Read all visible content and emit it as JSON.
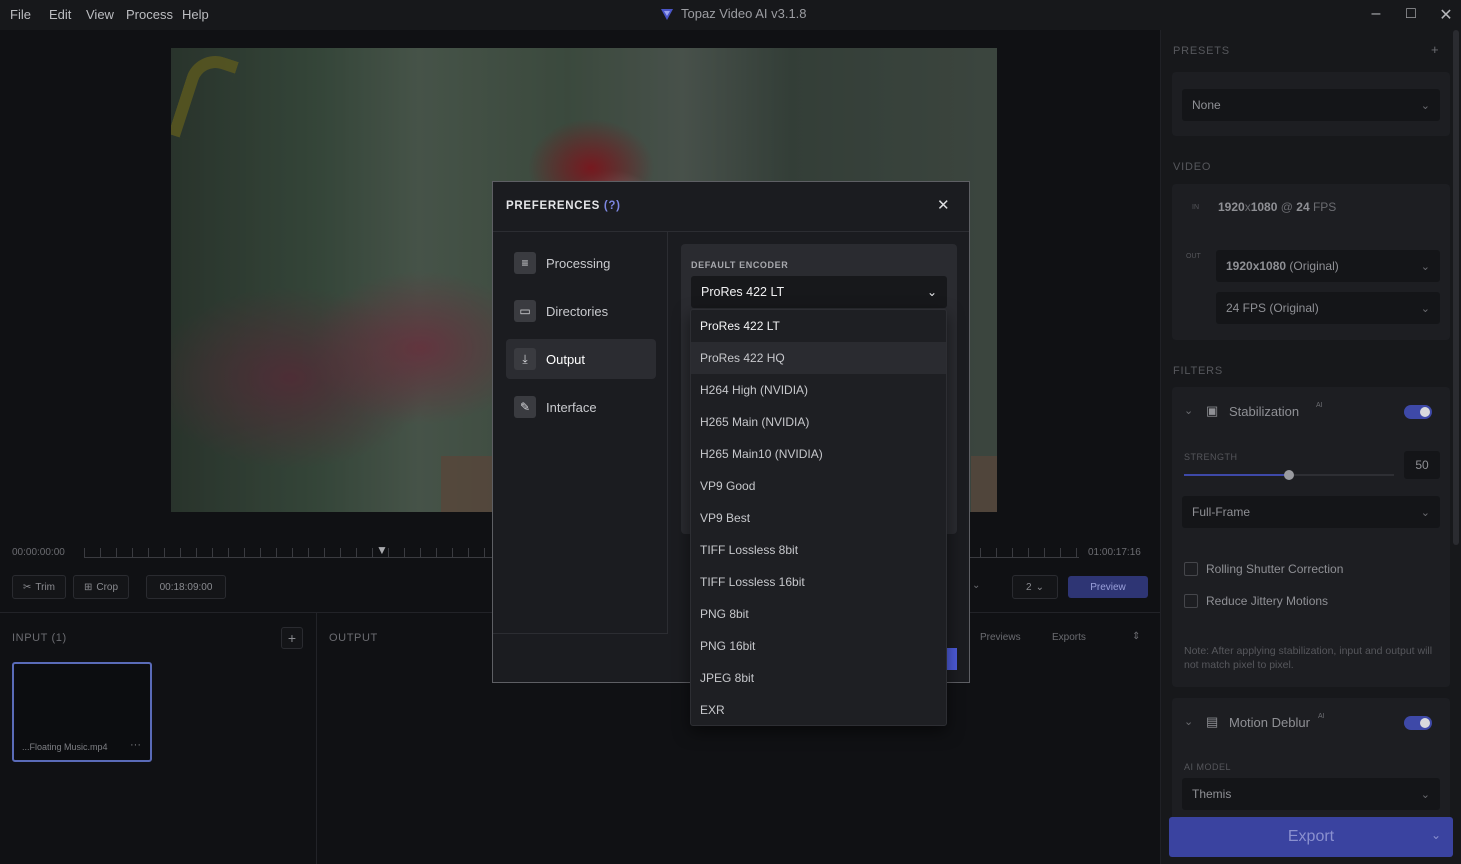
{
  "menubar": {
    "items": [
      "File",
      "Edit",
      "View",
      "Process",
      "Help"
    ],
    "title": "Topaz Video AI  v3.1.8",
    "logo_icon": "topaz-logo-icon",
    "controls": [
      "minimize-icon",
      "maximize-icon",
      "close-icon"
    ]
  },
  "timeline": {
    "start_time": "00:00:00:00",
    "end_time": "01:00:17:16",
    "trim_label": "Trim",
    "crop_label": "Crop",
    "timecode": "00:18:09:00",
    "view_count": "2",
    "preview_label": "Preview",
    "previews_tab": "Previews",
    "exports_tab": "Exports"
  },
  "input_panel": {
    "title": "INPUT (1)",
    "add_label": "+",
    "file_name": "...Floating Music.mp4",
    "more_label": "···"
  },
  "output_panel": {
    "title": "OUTPUT"
  },
  "right_panel": {
    "presets_title": "PRESETS",
    "presets_add": "+",
    "preset_value": "None",
    "video_title": "VIDEO",
    "in_label": "IN",
    "in_resolution": "1920",
    "in_x": "x",
    "in_height": "1080",
    "in_at": " @ ",
    "in_fps": "24",
    "in_fps_unit": " FPS",
    "out_label": "OUT",
    "out_resolution": "1920x1080",
    "out_resolution_note": "(Original)",
    "out_fps": "24 FPS (Original)",
    "filters_title": "FILTERS",
    "stabilization": {
      "name": "Stabilization",
      "ai_badge": "AI",
      "enabled": true,
      "strength_label": "STRENGTH",
      "strength_value": "50",
      "strength_fraction": 0.5,
      "mode": "Full-Frame",
      "rolling_shutter": "Rolling Shutter Correction",
      "reduce_jitter": "Reduce Jittery Motions",
      "note": "Note: After applying stabilization, input and output will not match pixel to pixel."
    },
    "motion_deblur": {
      "name": "Motion Deblur",
      "ai_badge": "AI",
      "enabled": true,
      "model_label": "AI MODEL",
      "model_value": "Themis"
    },
    "export_label": "Export"
  },
  "preferences": {
    "title": "PREFERENCES",
    "help": "(?)",
    "close_icon": "close-icon",
    "nav": [
      {
        "label": "Processing",
        "icon": "sliders-icon",
        "active": false
      },
      {
        "label": "Directories",
        "icon": "folder-icon",
        "active": false
      },
      {
        "label": "Output",
        "icon": "download-icon",
        "active": true
      },
      {
        "label": "Interface",
        "icon": "interface-icon",
        "active": false
      }
    ],
    "encoder_label": "DEFAULT ENCODER",
    "encoder_value": "ProRes 422 LT",
    "encoder_options": [
      "ProRes 422 LT",
      "ProRes 422 HQ",
      "H264 High (NVIDIA)",
      "H265 Main (NVIDIA)",
      "H265 Main10 (NVIDIA)",
      "VP9 Good",
      "VP9 Best",
      "TIFF Lossless 8bit",
      "TIFF Lossless 16bit",
      "PNG 8bit",
      "PNG 16bit",
      "JPEG 8bit",
      "EXR"
    ],
    "selected_index": 0,
    "hover_index": 1
  },
  "colors": {
    "accent": "#3e49a8",
    "modal_bg": "#1b1c20",
    "panel_bg": "#17181b"
  }
}
